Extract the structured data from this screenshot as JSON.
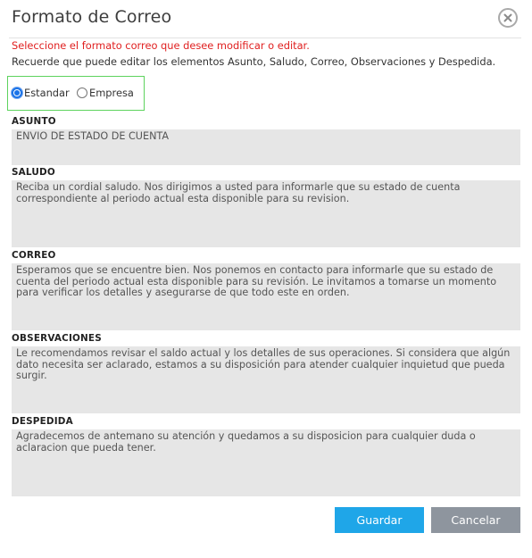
{
  "dialog": {
    "title": "Formato de Correo",
    "close_icon": "close-icon"
  },
  "messages": {
    "instruction_red": "Seleccione el formato correo que desee modificar o editar.",
    "instruction": "Recuerde que puede editar los elementos Asunto, Saludo, Correo, Observaciones y Despedida."
  },
  "format_options": {
    "selected": "Estandar",
    "estandar": "Estandar",
    "empresa": "Empresa"
  },
  "fields": {
    "asunto": {
      "label": "ASUNTO",
      "value": "ENVIO DE ESTADO DE CUENTA"
    },
    "saludo": {
      "label": "SALUDO",
      "value": "Reciba un cordial saludo. Nos dirigimos a usted para informarle que su estado de cuenta correspondiente al periodo actual esta disponible para su revision."
    },
    "correo": {
      "label": "CORREO",
      "value": "Esperamos que se encuentre bien. Nos ponemos en contacto para informarle que su estado de cuenta del periodo actual esta disponible para su revisión. Le invitamos a tomarse un momento para verificar los detalles y asegurarse de que todo este en orden."
    },
    "observaciones": {
      "label": "OBSERVACIONES",
      "value": "Le recomendamos revisar el saldo actual y los detalles de sus operaciones. Si considera que algún dato necesita ser aclarado, estamos a su disposición para atender cualquier inquietud que pueda surgir."
    },
    "despedida": {
      "label": "DESPEDIDA",
      "value": "Agradecemos de antemano su atención y quedamos a su disposicion para cualquier duda o aclaracion que pueda tener."
    }
  },
  "buttons": {
    "save": "Guardar",
    "cancel": "Cancelar"
  },
  "colors": {
    "accent_red": "#e02020",
    "radio_group_border": "#5ed35e",
    "save_button": "#1fa6e8",
    "cancel_button": "#8e959e",
    "field_background": "#e6e6e6"
  }
}
